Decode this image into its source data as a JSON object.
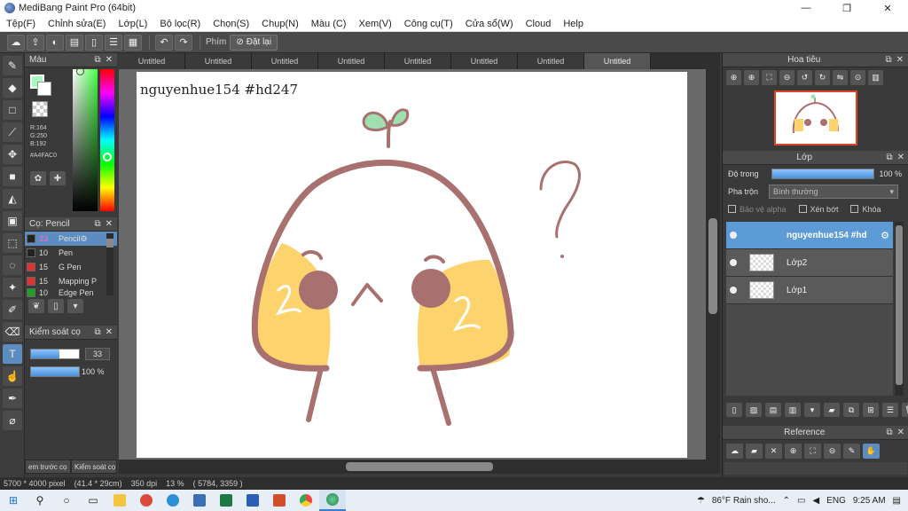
{
  "window": {
    "title": "MediBang Paint Pro (64bit)",
    "minimize": "—",
    "maximize": "❐",
    "close": "✕"
  },
  "menu": [
    "Tệp(F)",
    "Chỉnh sửa(E)",
    "Lớp(L)",
    "Bộ lọc(R)",
    "Chọn(S)",
    "Chụp(N)",
    "Màu (C)",
    "Xem(V)",
    "Công cụ(T)",
    "Cửa sổ(W)",
    "Cloud",
    "Help"
  ],
  "toolbar": {
    "shortcut_label": "Phím",
    "reset_label": "Đặt lại"
  },
  "color_panel": {
    "title": "Màu",
    "r": "R:164",
    "g": "G:250",
    "b": "B:192",
    "hex": "#A4FAC0",
    "foreground": "#a4fac0"
  },
  "brush_panel": {
    "title": "Cọ: Pencil",
    "items": [
      {
        "size": "33",
        "name": "Pencil",
        "color": "#222222"
      },
      {
        "size": "10",
        "name": "Pen",
        "color": "#222222"
      },
      {
        "size": "15",
        "name": "G Pen",
        "color": "#e03030"
      },
      {
        "size": "15",
        "name": "Mapping P",
        "color": "#e03030"
      },
      {
        "size": "10",
        "name": "Edge Pen",
        "color": "#20a020"
      }
    ]
  },
  "brush_control": {
    "title": "Kiểm soát cọ",
    "size": "33",
    "opacity": "100 %",
    "size_fraction": 0.6,
    "opacity_fraction": 1.0
  },
  "left_tabs": [
    "em trước cọ",
    "Kiểm soát cọ"
  ],
  "doc_tabs": [
    "Untitled",
    "Untitled",
    "Untitled",
    "Untitled",
    "Untitled",
    "Untitled",
    "Untitled",
    "Untitled"
  ],
  "canvas": {
    "text": "nguyenhue154   #hd247"
  },
  "navigator": {
    "title": "Hoa tiêu"
  },
  "layer_panel": {
    "title": "Lớp",
    "opacity_label": "Độ trong",
    "opacity_value": "100 %",
    "blend_label": "Pha trộn",
    "blend_value": "Bình thường",
    "protect_alpha": "Bảo vệ alpha",
    "clipping": "Xén bớt",
    "lock": "Khóa",
    "layers": [
      {
        "name": "nguyenhue154    #hd",
        "selected": true
      },
      {
        "name": "Lớp2",
        "selected": false
      },
      {
        "name": "Lớp1",
        "selected": false
      }
    ]
  },
  "reference": {
    "title": "Reference"
  },
  "status": {
    "size": "5700 * 4000 pixel",
    "cm": "(41.4 * 29cm)",
    "dpi": "350 dpi",
    "zoom": "13 %",
    "coords": "( 5784, 3359 )"
  },
  "taskbar": {
    "weather": "86°F  Rain sho...",
    "lang": "ENG",
    "time": "9:25 AM"
  },
  "colors": {
    "accent": "#5d8dc0",
    "sprout": "#9fe0b0",
    "stroke": "#a97070",
    "blush": "#fdd36e",
    "eye": "#a97070"
  }
}
